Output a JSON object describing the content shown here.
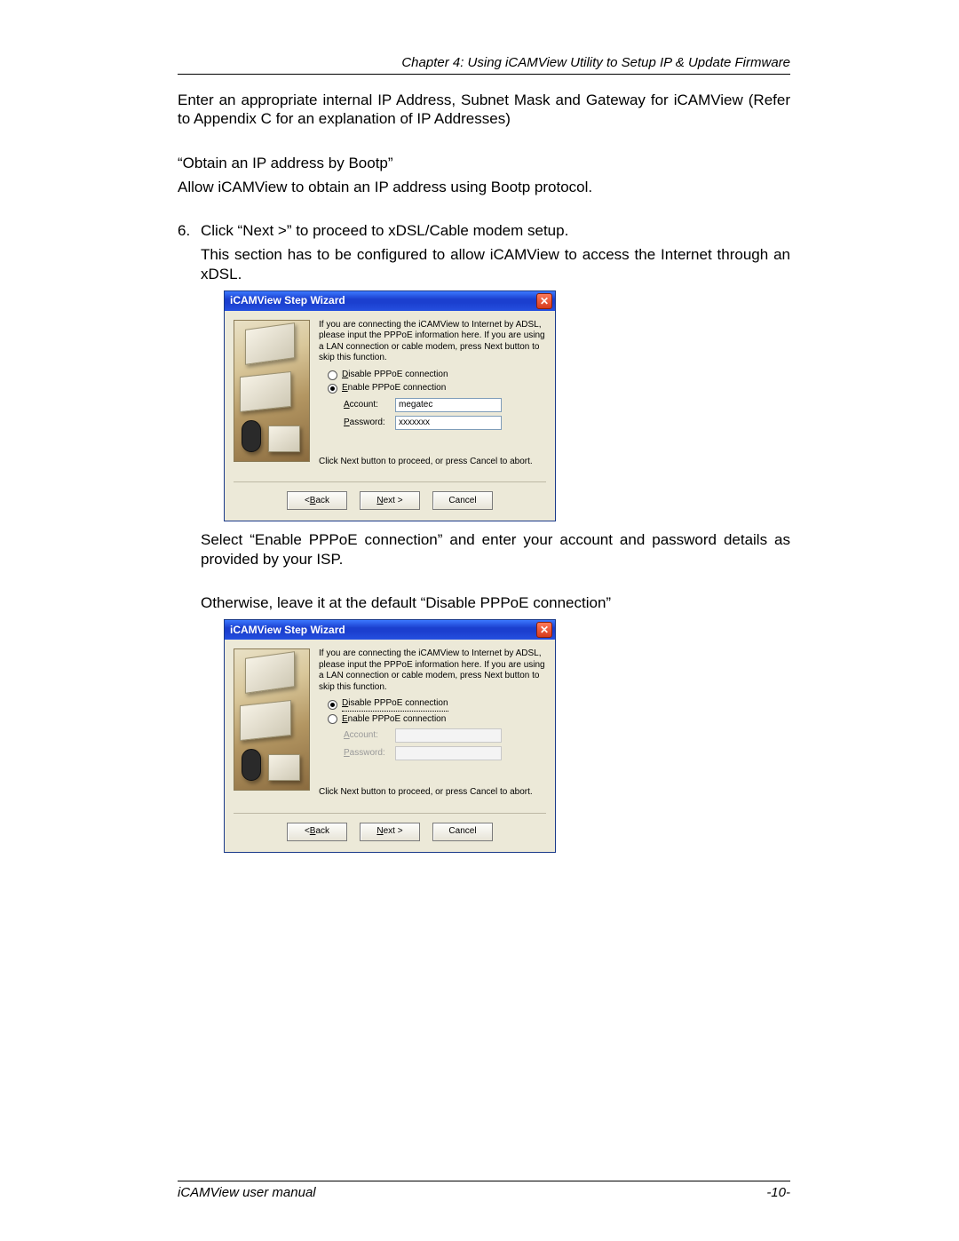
{
  "header": "Chapter 4: Using iCAMView Utility to Setup IP & Update Firmware",
  "body": {
    "p1": "Enter an appropriate internal IP Address, Subnet Mask and Gateway for iCAMView (Refer to Appendix C for an explanation of IP Addresses)",
    "p2": "“Obtain an IP address by Bootp”",
    "p3": "Allow iCAMView to obtain an IP address using Bootp protocol.",
    "list_num": "6.",
    "p4": "Click “Next >” to proceed to xDSL/Cable modem setup.",
    "p5": "This section has to be configured to allow iCAMView to access the Internet through an xDSL.",
    "p6": "Select “Enable PPPoE connection” and enter your account and password details as provided by your ISP.",
    "p7": "Otherwise, leave it at the default “Disable PPPoE connection”"
  },
  "dialog": {
    "title": "iCAMView Step Wizard",
    "close_glyph": "✕",
    "instruction": "If you are connecting the iCAMView to Internet by ADSL, please input the PPPoE information here. If you are using a LAN connection or cable modem, press Next button to skip this function.",
    "radio_disable_prefix": "D",
    "radio_disable_rest": "isable PPPoE connection",
    "radio_enable_prefix": "E",
    "radio_enable_rest": "nable PPPoE connection",
    "account_prefix": "A",
    "account_rest": "ccount:",
    "password_prefix": "P",
    "password_rest": "assword:",
    "account_value": "megatec",
    "password_value": "xxxxxxx",
    "proceed": "Click Next button to proceed, or press Cancel to abort.",
    "back_prefix": "< ",
    "back_u": "B",
    "back_rest": "ack",
    "next_u": "N",
    "next_rest": "ext >",
    "cancel": "Cancel"
  },
  "footer": {
    "left": "iCAMView user manual",
    "right": "-10-"
  }
}
